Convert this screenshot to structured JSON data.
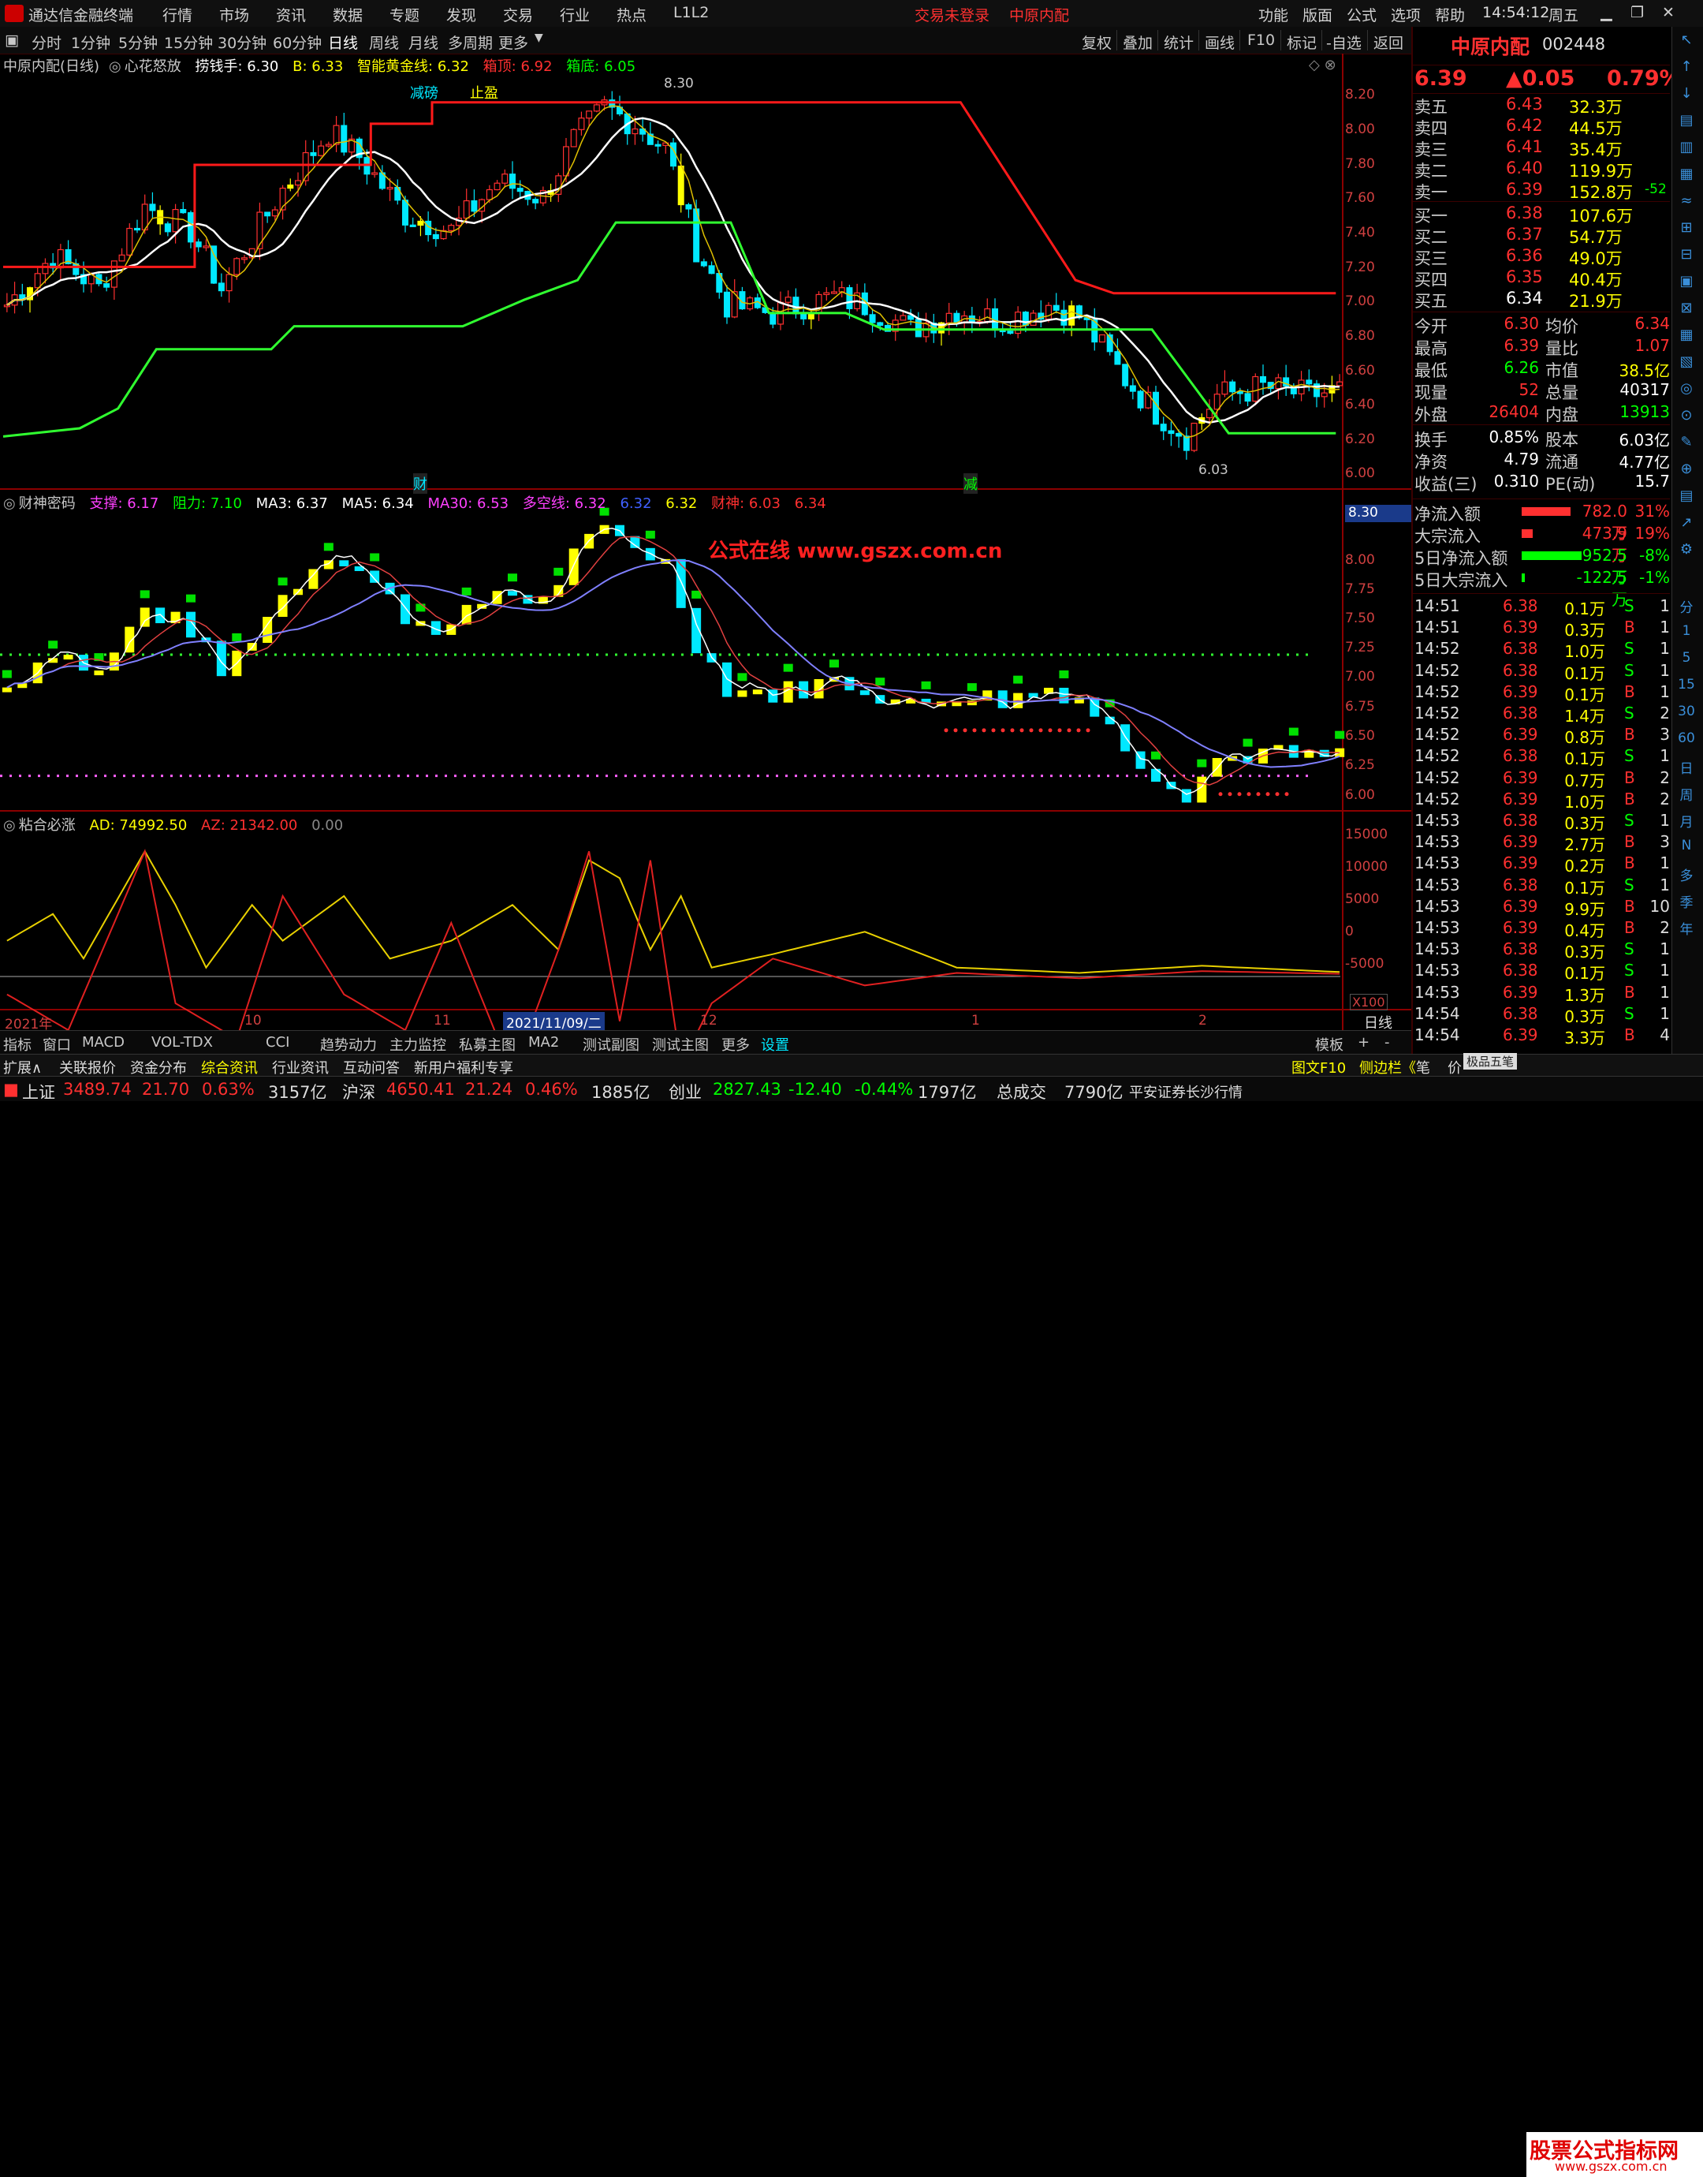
{
  "app": {
    "title": "通达信金融终端",
    "trade_status": "交易未登录",
    "stock_name": "中原内配",
    "time": "14:54:12",
    "weekday": "周五"
  },
  "menu": {
    "left": [
      "行情",
      "市场",
      "资讯",
      "数据",
      "专题",
      "发现",
      "交易",
      "行业",
      "热点",
      "L1L2"
    ],
    "right": [
      "功能",
      "版面",
      "公式",
      "选项",
      "帮助"
    ]
  },
  "toolbar": {
    "periods": [
      "分时",
      "1分钟",
      "5分钟",
      "15分钟",
      "30分钟",
      "60分钟",
      "日线",
      "周线",
      "月线",
      "多周期",
      "更多"
    ],
    "active": "日线",
    "right": [
      "复权",
      "叠加",
      "统计",
      "画线",
      "F10",
      "标记",
      "-自选",
      "返回"
    ]
  },
  "main_panel": {
    "title": "中原内配(日线)",
    "indicator": "心花怒放",
    "items": [
      "捞钱手: 6.30",
      "B: 6.33",
      "智能黄金线: 6.32",
      "箱顶: 6.92",
      "箱底: 6.05"
    ],
    "labels": {
      "jianbang": "减磅",
      "zhiying": "止盈",
      "cai": "财",
      "jian": "减"
    },
    "max_label": "8.30",
    "min_label": "6.03",
    "axis": [
      "8.20",
      "8.00",
      "7.80",
      "7.60",
      "7.40",
      "7.20",
      "7.00",
      "6.80",
      "6.60",
      "6.40",
      "6.20",
      "6.00"
    ]
  },
  "panel2": {
    "title": "财神密码",
    "items": [
      "支撑: 6.17",
      "阻力: 7.10",
      "MA3: 6.37",
      "MA5: 6.34",
      "MA30: 6.53",
      "多空线: 6.32",
      "6.32",
      "6.32",
      "财神: 6.03",
      "6.34"
    ],
    "watermark": "公式在线 www.gszx.com.cn",
    "axis_tag": "8.30",
    "axis": [
      "8.00",
      "7.75",
      "7.50",
      "7.25",
      "7.00",
      "6.75",
      "6.50",
      "6.25",
      "6.00"
    ]
  },
  "panel3": {
    "title": "粘合必涨",
    "items": [
      "AD: 74992.50",
      "AZ: 21342.00",
      "0.00"
    ],
    "axis": [
      "15000",
      "10000",
      "5000",
      "0",
      "-5000"
    ],
    "multiplier": "X100"
  },
  "time_axis": {
    "labels": [
      "2021年",
      "10",
      "11",
      "2021/11/09/二",
      "12",
      "1",
      "2"
    ],
    "period": "日线"
  },
  "quote": {
    "name": "中原内配",
    "code": "002448",
    "price": "6.39",
    "change": "▲0.05",
    "pct": "0.79%",
    "sells": [
      [
        "卖五",
        "6.43",
        "32.3万",
        ""
      ],
      [
        "卖四",
        "6.42",
        "44.5万",
        ""
      ],
      [
        "卖三",
        "6.41",
        "35.4万",
        ""
      ],
      [
        "卖二",
        "6.40",
        "119.9万",
        ""
      ],
      [
        "卖一",
        "6.39",
        "152.8万",
        "-52"
      ]
    ],
    "buys": [
      [
        "买一",
        "6.38",
        "107.6万"
      ],
      [
        "买二",
        "6.37",
        "54.7万"
      ],
      [
        "买三",
        "6.36",
        "49.0万"
      ],
      [
        "买四",
        "6.35",
        "40.4万"
      ],
      [
        "买五",
        "6.34",
        "21.9万"
      ]
    ],
    "stats": [
      [
        "今开",
        "6.30",
        "均价",
        "6.34"
      ],
      [
        "最高",
        "6.39",
        "量比",
        "1.07"
      ],
      [
        "最低",
        "6.26",
        "市值",
        "38.5亿"
      ],
      [
        "现量",
        "52",
        "总量",
        "40317"
      ],
      [
        "外盘",
        "26404",
        "内盘",
        "13913"
      ],
      [
        "换手",
        "0.85%",
        "股本",
        "6.03亿"
      ],
      [
        "净资",
        "4.79",
        "流通",
        "4.77亿"
      ],
      [
        "收益(三)",
        "0.310",
        "PE(动)",
        "15.7"
      ]
    ],
    "flows": [
      [
        "净流入额",
        "782.0万",
        "31%"
      ],
      [
        "大宗流入",
        "473.9万",
        "19%"
      ],
      [
        "5日净流入额",
        "-952.5万",
        "-8%"
      ],
      [
        "5日大宗流入",
        "-122.5万",
        "-1%"
      ]
    ],
    "ticks": [
      [
        "14:51",
        "6.38",
        "0.1万",
        "S",
        "1"
      ],
      [
        "14:51",
        "6.39",
        "0.3万",
        "B",
        "1"
      ],
      [
        "14:52",
        "6.38",
        "1.0万",
        "S",
        "1"
      ],
      [
        "14:52",
        "6.38",
        "0.1万",
        "S",
        "1"
      ],
      [
        "14:52",
        "6.39",
        "0.1万",
        "B",
        "1"
      ],
      [
        "14:52",
        "6.38",
        "1.4万",
        "S",
        "2"
      ],
      [
        "14:52",
        "6.39",
        "0.8万",
        "B",
        "3"
      ],
      [
        "14:52",
        "6.38",
        "0.1万",
        "S",
        "1"
      ],
      [
        "14:52",
        "6.39",
        "0.7万",
        "B",
        "2"
      ],
      [
        "14:52",
        "6.39",
        "1.0万",
        "B",
        "2"
      ],
      [
        "14:53",
        "6.38",
        "0.3万",
        "S",
        "1"
      ],
      [
        "14:53",
        "6.39",
        "2.7万",
        "B",
        "3"
      ],
      [
        "14:53",
        "6.39",
        "0.2万",
        "B",
        "1"
      ],
      [
        "14:53",
        "6.38",
        "0.1万",
        "S",
        "1"
      ],
      [
        "14:53",
        "6.39",
        "9.9万",
        "B",
        "10"
      ],
      [
        "14:53",
        "6.39",
        "0.4万",
        "B",
        "2"
      ],
      [
        "14:53",
        "6.38",
        "0.3万",
        "S",
        "1"
      ],
      [
        "14:53",
        "6.38",
        "0.1万",
        "S",
        "1"
      ],
      [
        "14:53",
        "6.39",
        "1.3万",
        "B",
        "1"
      ],
      [
        "14:54",
        "6.38",
        "0.3万",
        "S",
        "1"
      ],
      [
        "14:54",
        "6.39",
        "3.3万",
        "B",
        "4"
      ]
    ]
  },
  "side_icons": [
    "分",
    "1",
    "5",
    "15",
    "30",
    "60",
    "日",
    "周",
    "月",
    "N",
    "多",
    "季",
    "年"
  ],
  "bottom_tabs": [
    "指标",
    "窗口",
    "MACD",
    "VOL-TDX",
    "CCI",
    "趋势动力",
    "主力监控",
    "私募主图",
    "MA2",
    "测试副图",
    "测试主图",
    "更多",
    "设置"
  ],
  "bottom_right": [
    "模板",
    "+",
    "-"
  ],
  "info_tabs": [
    "扩展∧",
    "关联报价",
    "资金分布",
    "综合资讯",
    "行业资讯",
    "互动问答",
    "新用户福利专享"
  ],
  "info_right": [
    "图文F10",
    "侧边栏《",
    "笔",
    "价"
  ],
  "status": {
    "sh_label": "上证",
    "sh": "3489.74",
    "sh_chg": "21.70",
    "sh_pct": "0.63%",
    "sh_amt": "3157亿",
    "sz_label": "沪深",
    "sz": "4650.41",
    "sz_chg": "21.24",
    "sz_pct": "0.46%",
    "sz_amt": "1885亿",
    "cy_label": "创业",
    "cy": "2827.43",
    "cy_chg": "-12.40",
    "cy_pct": "-0.44%",
    "cy_amt": "1797亿",
    "total_label": "总成交",
    "total": "7790亿",
    "broker": "平安证券长沙行情",
    "site": "股票公式指标网",
    "site_url": "www.gszx.com.cn",
    "site_sub": "极品五笔"
  },
  "colors": {
    "up": "#ff3030",
    "down": "#00e8ff",
    "green": "#00ff00",
    "yellow": "#ffff00",
    "white": "#ffffff"
  }
}
